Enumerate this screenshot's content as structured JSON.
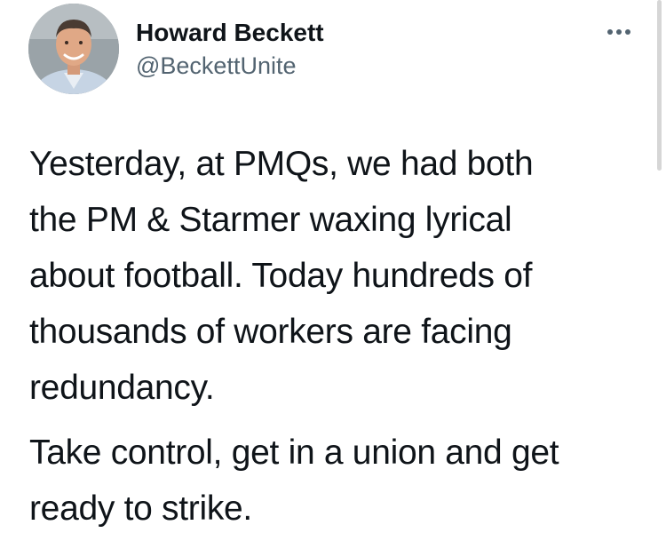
{
  "author": {
    "display_name": "Howard Beckett",
    "handle": "@BeckettUnite",
    "avatar_icon": "profile-photo"
  },
  "header": {
    "more_icon": "more-horizontal-icon"
  },
  "tweet": {
    "paragraph_1_lines": [
      "Yesterday, at PMQs, we had both",
      "the PM & Starmer waxing lyrical",
      "about football. Today hundreds of",
      "thousands of workers are facing",
      "redundancy."
    ],
    "paragraph_2_lines": [
      "Take control, get in a union and get",
      "ready to strike."
    ]
  },
  "colors": {
    "text": "#0f1419",
    "secondary_text": "#536471",
    "background": "#ffffff"
  }
}
